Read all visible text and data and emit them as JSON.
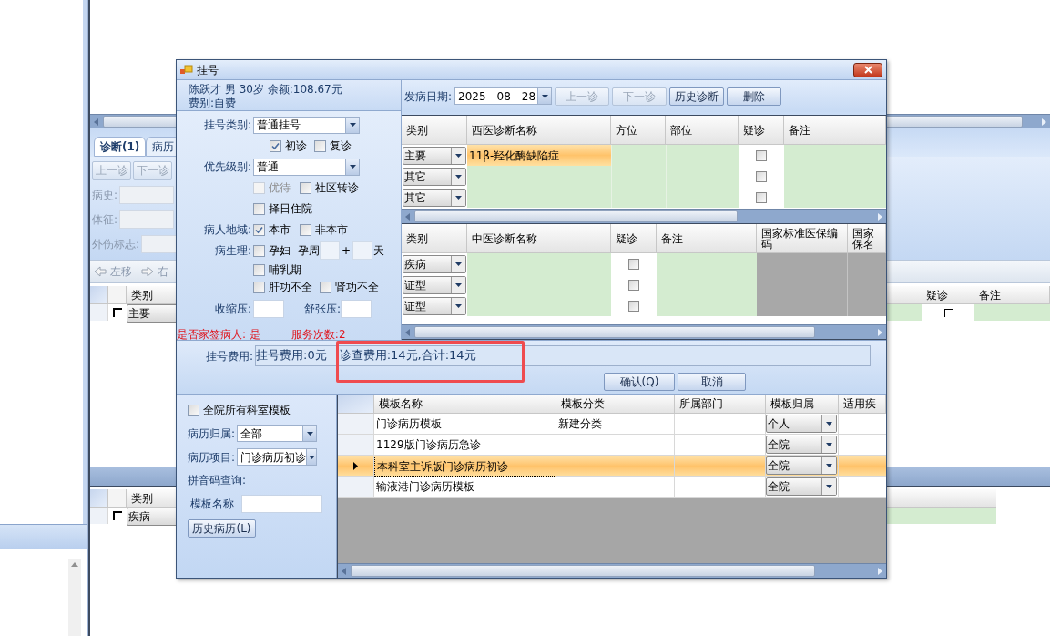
{
  "background": {
    "tabs": [
      {
        "label": "诊断(1)",
        "selected": true
      },
      {
        "label": "病历",
        "selected": false
      }
    ],
    "nav_buttons": [
      "上一诊",
      "下一诊"
    ],
    "fields": [
      "病史:",
      "体征:",
      "外伤标志:"
    ],
    "toolbar": [
      "左移",
      "右"
    ],
    "grid_top": {
      "columns": [
        "类别",
        "疑诊",
        "备注"
      ],
      "rows": [
        {
          "category": "主要",
          "suspected": false
        }
      ]
    },
    "grid_bottom": {
      "columns": [
        "类别"
      ],
      "rows": [
        {
          "category": "疾病",
          "suspected": false
        }
      ]
    }
  },
  "dialog": {
    "title": "挂号",
    "patient": {
      "line1": "陈跃才 男 30岁 余额:108.67元",
      "line2": "费别:自费"
    },
    "form": {
      "reg_type_label": "挂号类别:",
      "reg_type": "普通挂号",
      "visit_checks": [
        {
          "label": "初诊",
          "checked": true,
          "disabled": false
        },
        {
          "label": "复诊",
          "checked": false,
          "disabled": false
        }
      ],
      "priority_label": "优先级别:",
      "priority": "普通",
      "priority_checks": [
        {
          "label": "优待",
          "checked": false,
          "disabled": true
        },
        {
          "label": "社区转诊",
          "checked": false,
          "disabled": false
        }
      ],
      "admit_check": {
        "label": "择日住院",
        "checked": false,
        "disabled": false
      },
      "region_label": "病人地域:",
      "region_checks": [
        {
          "label": "本市",
          "checked": true,
          "disabled": false
        },
        {
          "label": "非本市",
          "checked": false,
          "disabled": false
        }
      ],
      "physio_label": "病生理:",
      "pregnant": {
        "label": "孕妇",
        "checked": false,
        "disabled": false
      },
      "week_label": "孕周",
      "plus": "+",
      "day_label": "天",
      "lactation": {
        "label": "哺乳期",
        "checked": false,
        "disabled": false
      },
      "organ_checks": [
        {
          "label": "肝功不全",
          "checked": false,
          "disabled": false
        },
        {
          "label": "肾功不全",
          "checked": false,
          "disabled": false
        }
      ],
      "systolic_label": "收缩压:",
      "diastolic_label": "舒张压:",
      "family_doctor": "是否家签病人: 是",
      "service_count": "服务次数:2"
    },
    "onset_label": "发病日期:",
    "onset_date": "2025 - 08 - 28",
    "diag_buttons": [
      {
        "label": "上一诊",
        "disabled": true
      },
      {
        "label": "下一诊",
        "disabled": true
      },
      {
        "label": "历史诊断",
        "disabled": false
      },
      {
        "label": "删除",
        "disabled": false
      }
    ],
    "western": {
      "columns": [
        "类别",
        "西医诊断名称",
        "方位",
        "部位",
        "疑诊",
        "备注"
      ],
      "rows": [
        {
          "category": "主要",
          "name": "11β-羟化酶缺陷症",
          "selected": true,
          "suspected": false
        },
        {
          "category": "其它",
          "selected": false,
          "suspected": false
        },
        {
          "category": "其它",
          "selected": false,
          "suspected": false
        }
      ]
    },
    "chinese": {
      "columns": [
        "类别",
        "中医诊断名称",
        "疑诊",
        "备注",
        "国家标准医保编码",
        "国家保名"
      ],
      "rows": [
        {
          "category": "疾病",
          "suspected": false
        },
        {
          "category": "证型",
          "suspected": false
        },
        {
          "category": "证型",
          "suspected": false
        }
      ]
    },
    "fee_label": "挂号费用:",
    "fee_parts": [
      "挂号费用:0元",
      "诊查费用:14元,合计:14元"
    ],
    "confirm": "确认(Q)",
    "cancel": "取消",
    "templates_filter": {
      "all_check": {
        "label": "全院所有科室模板",
        "checked": false,
        "disabled": false
      },
      "owner_label": "病历归属:",
      "owner": "全部",
      "item_label": "病历项目:",
      "item": "门诊病历初诊",
      "pinyin_label": "拼音码查询:",
      "name_label": "模板名称",
      "history_button": "历史病历(L)"
    },
    "templates": {
      "columns": [
        "模板名称",
        "模板分类",
        "所属部门",
        "模板归属",
        "适用疾"
      ],
      "rows": [
        {
          "name": "门诊病历模板",
          "category": "新建分类",
          "scope": "个人",
          "selected": false
        },
        {
          "name": "1129版门诊病历急诊",
          "scope": "全院",
          "selected": false
        },
        {
          "name": "本科室主诉版门诊病历初诊",
          "scope": "全院",
          "selected": true
        },
        {
          "name": "输液港门诊病历模板",
          "scope": "全院",
          "selected": false
        }
      ]
    }
  }
}
